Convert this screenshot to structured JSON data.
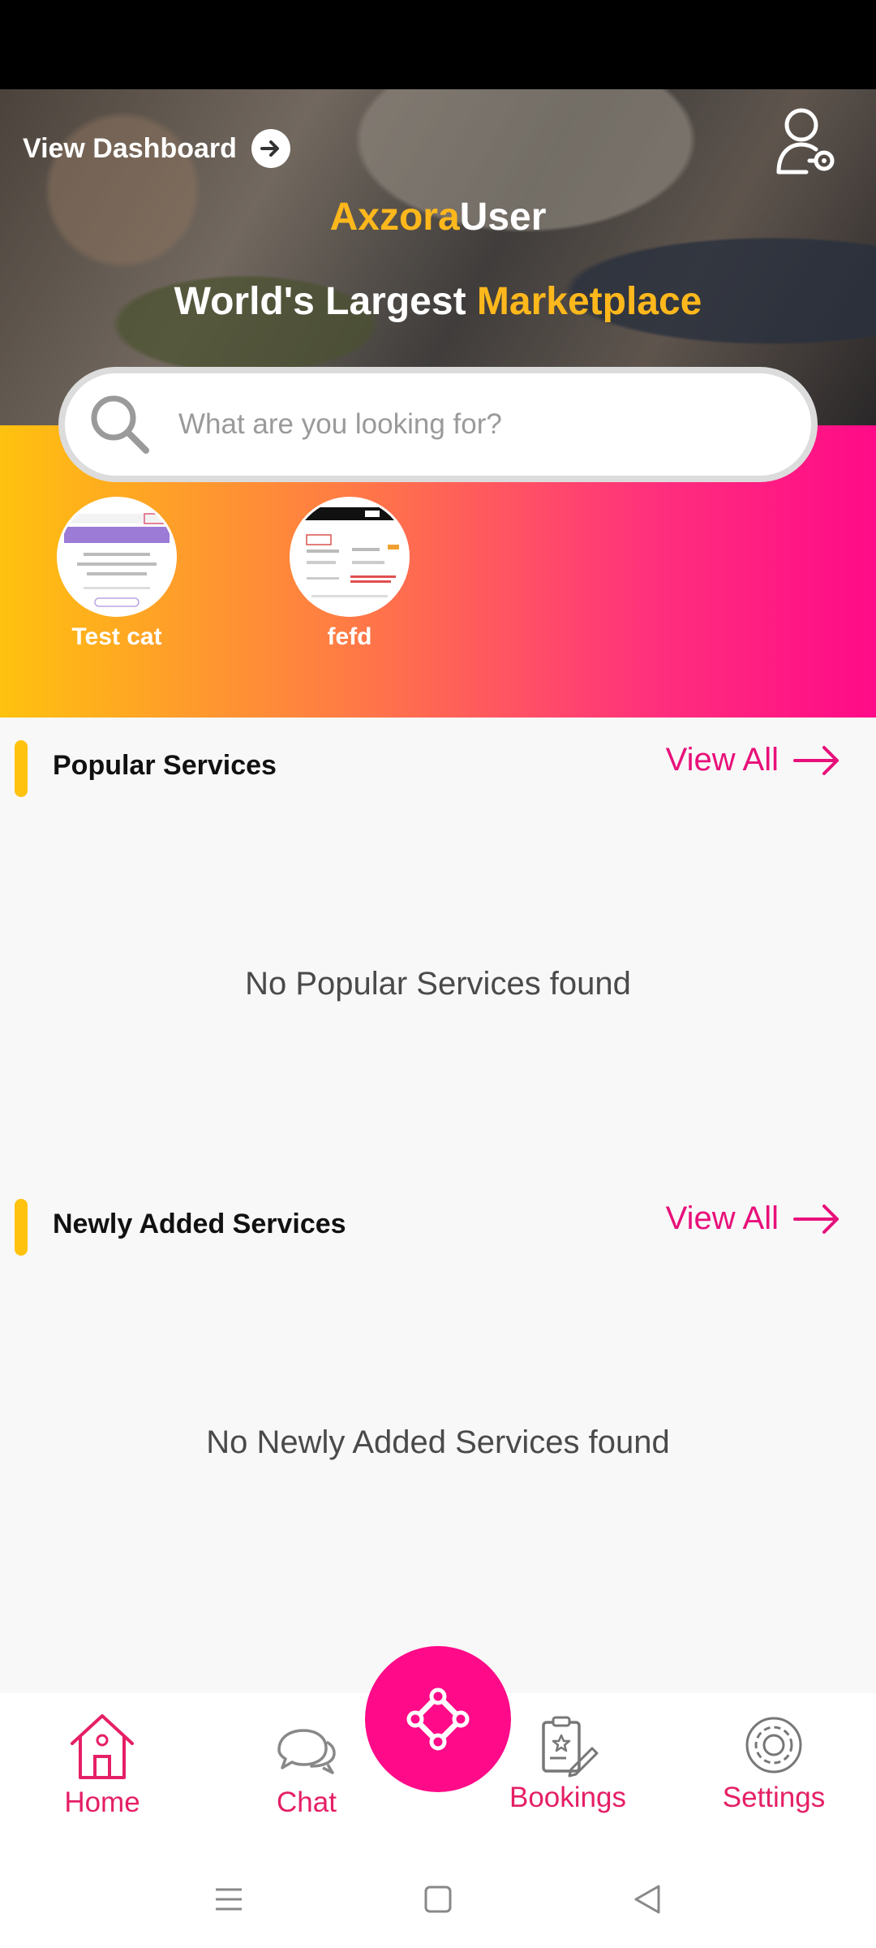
{
  "header": {
    "view_dashboard_label": "View Dashboard",
    "brand_first": "Axzora",
    "brand_second": "User",
    "tagline_prefix": "World's Largest ",
    "tagline_accent": "Marketplace"
  },
  "search": {
    "placeholder": "What are you looking for?"
  },
  "categories": [
    {
      "name": "Test cat"
    },
    {
      "name": "fefd"
    }
  ],
  "popular": {
    "title": "Popular Services",
    "view_all": "View All",
    "empty_message": "No Popular Services found"
  },
  "newly_added": {
    "title": "Newly Added Services",
    "view_all": "View All",
    "empty_message": "No Newly Added Services found"
  },
  "bottom_nav": {
    "home": "Home",
    "chat": "Chat",
    "bookings": "Bookings",
    "settings": "Settings"
  },
  "colors": {
    "accent_pink": "#e8107a",
    "accent_yellow": "#ffb81c",
    "fab_pink": "#ff0a88"
  },
  "icons": [
    "arrow-right-circle-icon",
    "user-lock-icon",
    "search-icon",
    "arrow-right-icon",
    "home-icon",
    "chat-icon",
    "connect-icon",
    "bookings-icon",
    "settings-icon",
    "menu-icon",
    "square-icon",
    "back-triangle-icon"
  ]
}
